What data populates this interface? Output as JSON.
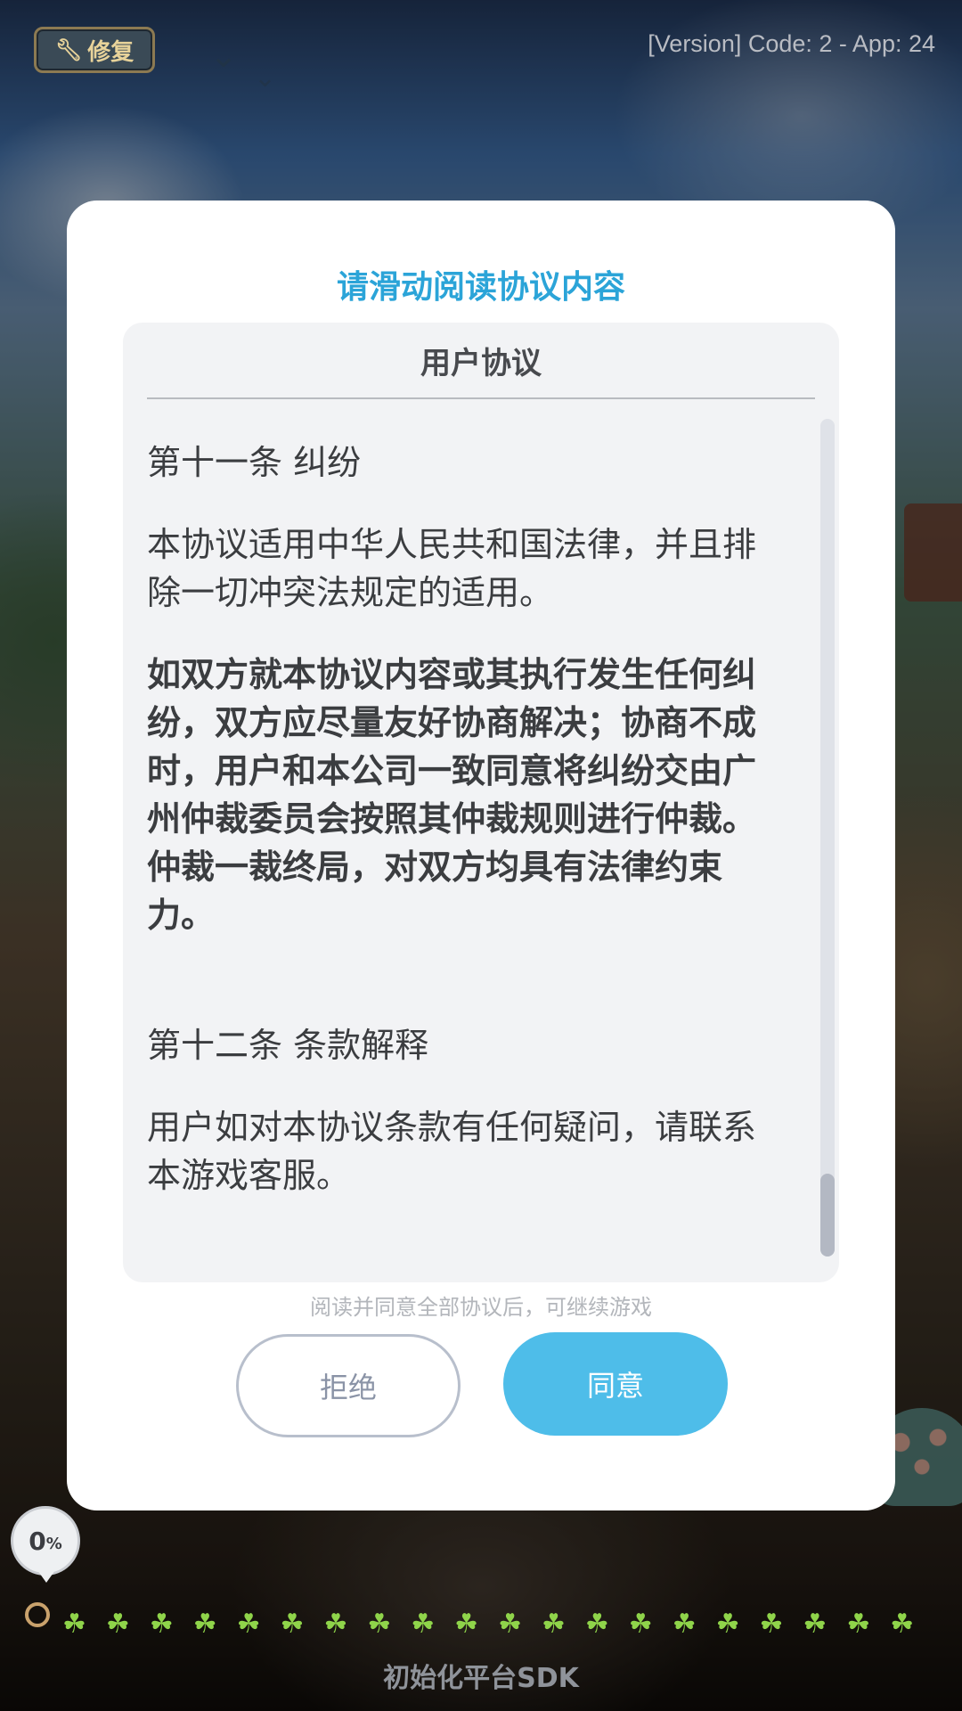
{
  "top_bar": {
    "repair_label": "修复",
    "version_text": "[Version] Code: 2 - App: 24"
  },
  "dialog": {
    "title": "请滑动阅读协议内容",
    "panel": {
      "header": "用户协议",
      "section11_title": "第十一条 纠纷",
      "section11_para1": "本协议适用中华人民共和国法律，并且排除一切冲突法规定的适用。",
      "section11_para2": "如双方就本协议内容或其执行发生任何纠纷，双方应尽量友好协商解决；协商不成时，用户和本公司一致同意将纠纷交由广州仲裁委员会按照其仲裁规则进行仲裁。仲裁一裁终局，对双方均具有法律约束力。",
      "section12_title": "第十二条 条款解释",
      "section12_para1": "用户如对本协议条款有任何疑问，请联系本游戏客服。",
      "scroll_position": 0.9
    },
    "hint": "阅读并同意全部协议后，可继续游戏",
    "reject_label": "拒绝",
    "agree_label": "同意"
  },
  "loading": {
    "progress_value": "0",
    "progress_unit": "%",
    "footer_text": "初始化平台SDK"
  },
  "colors": {
    "title": "#2ba4d8",
    "agree_button": "#4ebde9",
    "panel_bg": "#f2f3f5"
  },
  "icons": {
    "repair": "wrench-icon",
    "sprout": "sprout-icon",
    "snail": "snail-icon"
  }
}
